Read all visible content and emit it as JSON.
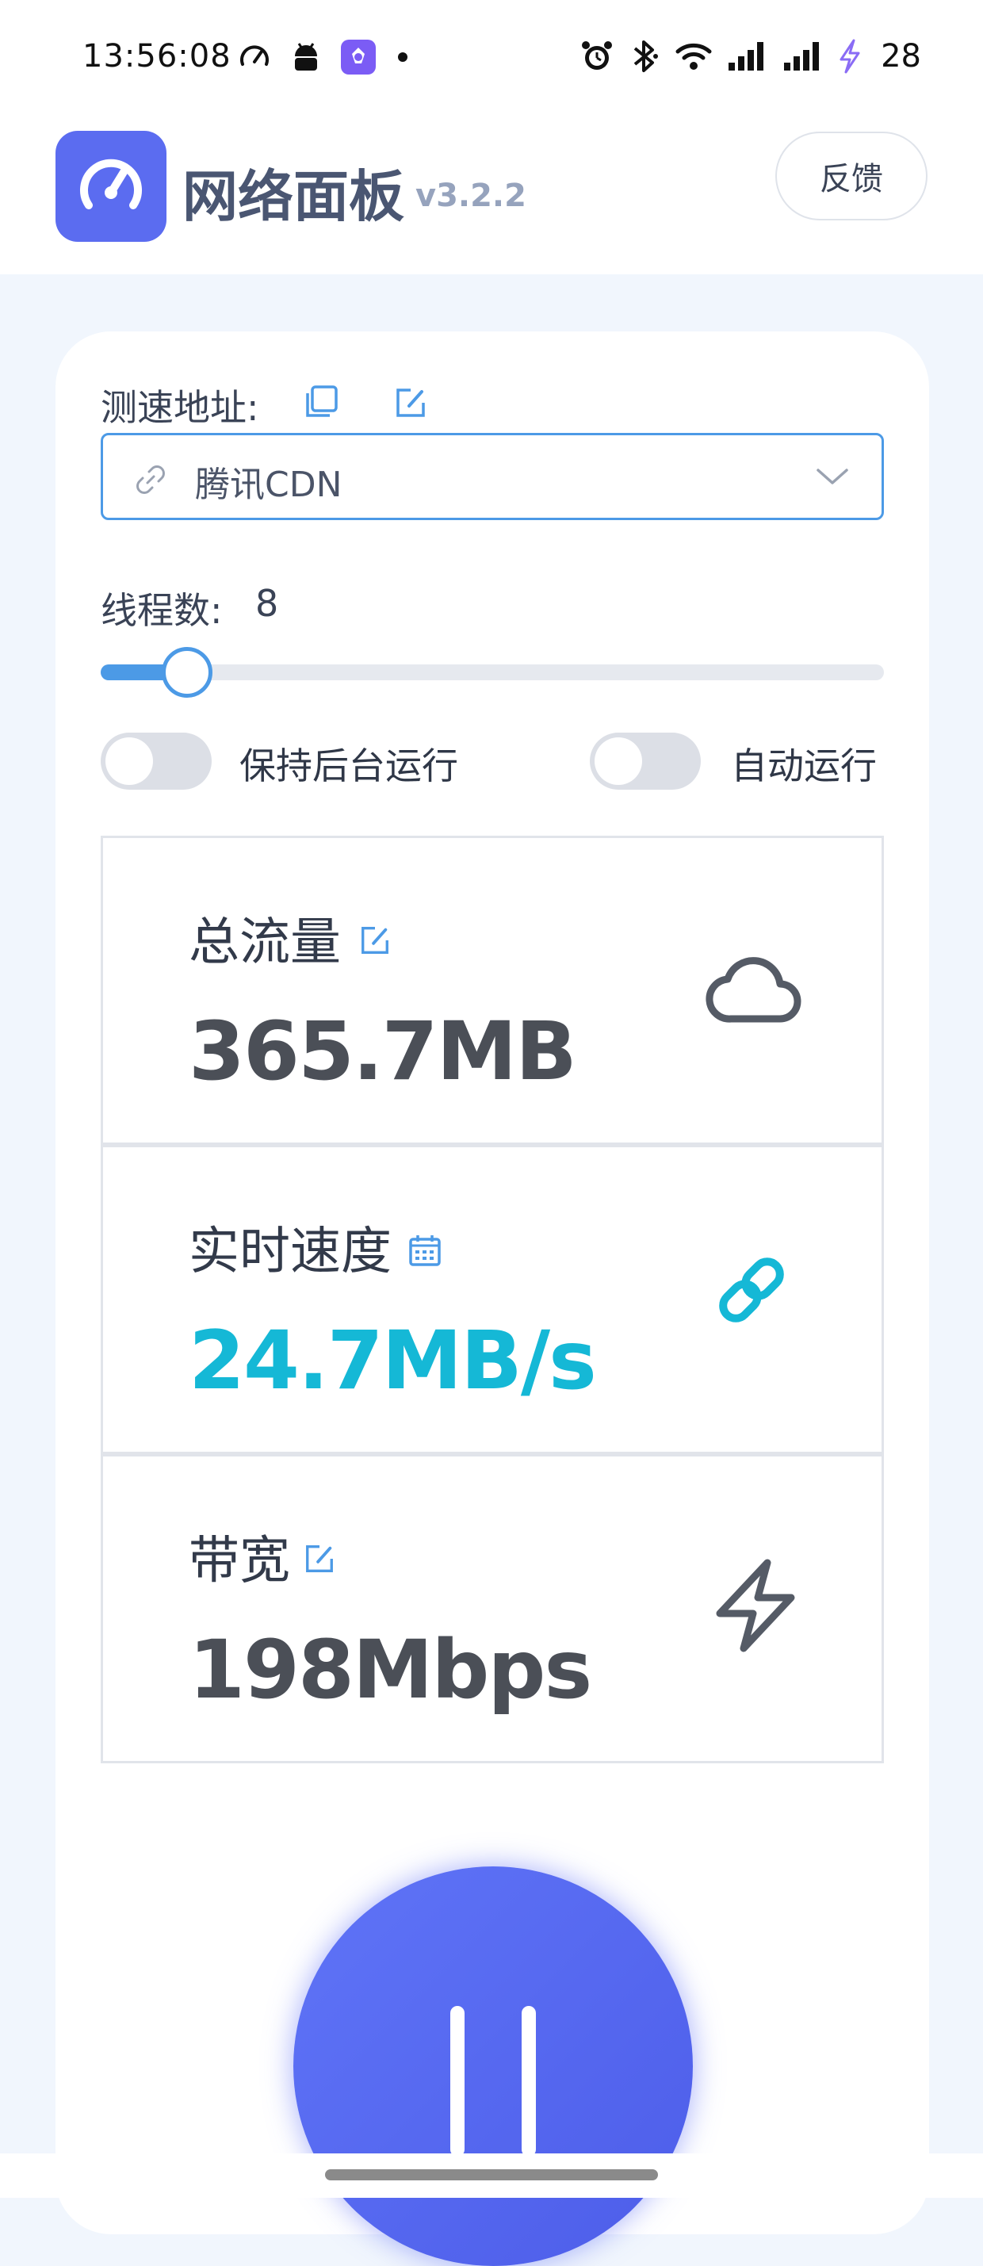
{
  "status_bar": {
    "time": "13:56:08",
    "battery": "28",
    "icons": [
      "speedometer-icon",
      "android-icon",
      "app-icon",
      "dot-icon",
      "alarm-icon",
      "bluetooth-icon",
      "wifi-icon",
      "signal-icon",
      "signal-icon",
      "charging-icon"
    ]
  },
  "header": {
    "title": "网络面板",
    "version": "v3.2.2",
    "feedback_label": "反馈"
  },
  "speed_test": {
    "address_label": "测速地址:",
    "selected_source": "腾讯CDN",
    "threads_label": "线程数:",
    "threads_value": "8",
    "threads_fraction": 0.11
  },
  "toggles": {
    "keep_background_label": "保持后台运行",
    "keep_background_on": false,
    "auto_run_label": "自动运行",
    "auto_run_on": false
  },
  "stats": [
    {
      "label": "总流量",
      "value": "365.7MB",
      "side_icon": "cloud-icon",
      "edit_icon": "edit-icon"
    },
    {
      "label": "实时速度",
      "value": "24.7MB/s",
      "side_icon": "link-icon",
      "edit_icon": "calendar-icon"
    },
    {
      "label": "带宽",
      "value": "198Mbps",
      "side_icon": "lightning-icon",
      "edit_icon": "edit-icon"
    }
  ],
  "colors": {
    "accent": "#4c9ae6",
    "brand": "#5b6cf0",
    "speed": "#15b8d6"
  }
}
